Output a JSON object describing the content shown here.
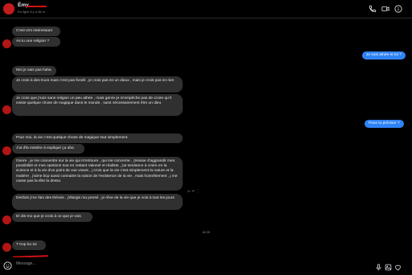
{
  "header": {
    "name": "Èmy",
    "status": "En ligne il y a 26 m"
  },
  "messages": [
    {
      "text": "C'est vrm intéressant"
    },
    {
      "text": "As tu une religion ?"
    },
    {
      "text": "Je suis athée et toi ?"
    },
    {
      "text": "Moi je sais pas haha"
    },
    {
      "text": "Je crois à des trucs mais c'est pas fondé , je crois pas en un dieux , mais je crois pas en rien"
    },
    {
      "text": "Je crois que j'suis sans religion un peu athée , mais genre je m'empêche pas de croire qu'il existe quelque chose de magique dans le monde , sans nécessairement être un dieu"
    },
    {
      "text": "Peux tu préciser ?"
    },
    {
      "text": "Pour moi, la vie c'est quelque chose de magique tout simplement."
    },
    {
      "text": "J'ai d'la mistère à expliqué ça aha"
    },
    {
      "text": "Genre , je me concentre sur la vie qui m'entoure , qui me concerne , j'essaie d'aggrandir mes possibilité et mes opetions tout en restant rationel et réaliste , j'ai tendance à croire en la science et à la vie d'un point de vue vivant , j crois que la vie c'est simplement la nature et la matière , j'aime bcp aussi connaitre la raison de l'existence de la vie , mais honnêtement , j me casse pas la tête la dessu"
    },
    {
      "text": "Desfois j'me fais des théorie , j'élargis ma pensé , je rêve de la vie que je vois à tout les jours"
    },
    {
      "text": "Et dis-mo que je crois à ce que je vois"
    },
    {
      "text": "T trop bo toi"
    }
  ],
  "timestamp": "18:39",
  "composer": {
    "placeholder": "Message..."
  },
  "colors": {
    "background": "#000000",
    "incoming_bubble": "#303030",
    "outgoing_bubble": "#2f83f5",
    "redaction": "#d01010"
  }
}
